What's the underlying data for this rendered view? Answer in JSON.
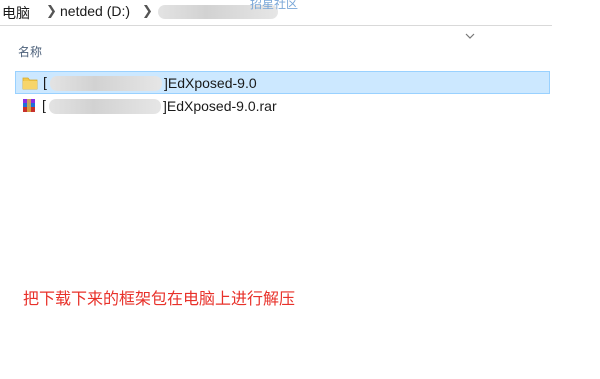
{
  "breadcrumb": {
    "items": [
      "电脑",
      "netded (D:)"
    ]
  },
  "watermark": "招星社区",
  "column": {
    "name_header": "名称"
  },
  "files": [
    {
      "name": "]EdXposed-9.0",
      "type": "folder",
      "selected": true
    },
    {
      "name": "]EdXposed-9.0.rar",
      "type": "archive",
      "selected": false
    }
  ],
  "caption": "把下载下来的框架包在电脑上进行解压",
  "colors": {
    "selection_bg": "#cce8ff",
    "selection_border": "#99d1ff",
    "caption": "#e8312a",
    "folder": "#f2c94c"
  },
  "icons": [
    "chevron-right-icon",
    "chevron-down-icon",
    "folder-icon",
    "winrar-archive-icon"
  ]
}
